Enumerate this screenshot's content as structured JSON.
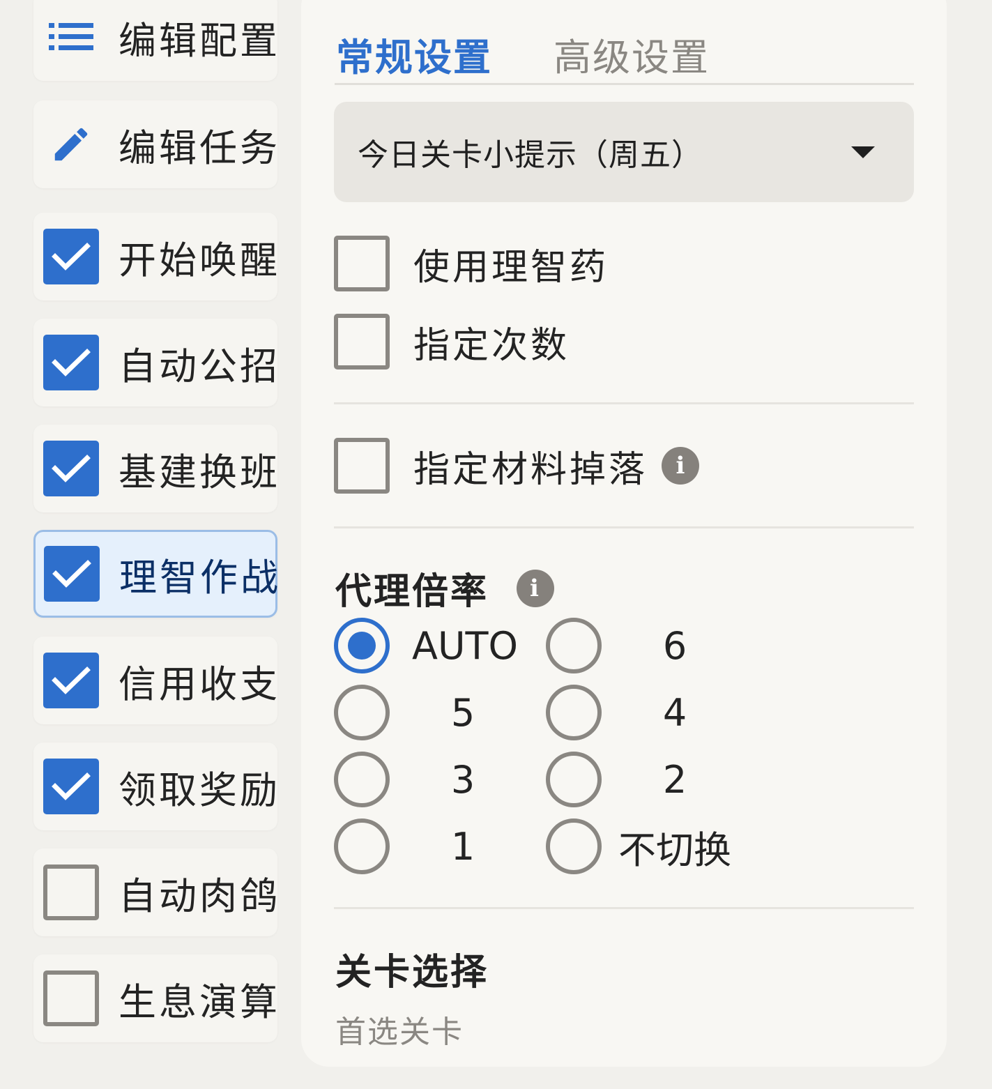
{
  "sidebar": {
    "items": [
      {
        "label": "编辑配置",
        "icon": "list-icon",
        "state": "icon"
      },
      {
        "label": "编辑任务",
        "icon": "pencil-icon",
        "state": "icon"
      },
      {
        "label": "开始唤醒",
        "state": "checked"
      },
      {
        "label": "自动公招",
        "state": "checked"
      },
      {
        "label": "基建换班",
        "state": "checked"
      },
      {
        "label": "理智作战",
        "state": "checked",
        "active": true
      },
      {
        "label": "信用收支",
        "state": "checked"
      },
      {
        "label": "领取奖励",
        "state": "checked"
      },
      {
        "label": "自动肉鸽",
        "state": "unchecked"
      },
      {
        "label": "生息演算",
        "state": "unchecked"
      }
    ]
  },
  "tabs": {
    "general": "常规设置",
    "advanced": "高级设置",
    "active": "general"
  },
  "stage_tip_dropdown": {
    "value": "今日关卡小提示（周五）"
  },
  "options": {
    "use_sanity_potion": {
      "label": "使用理智药",
      "checked": false
    },
    "specify_times": {
      "label": "指定次数",
      "checked": false
    },
    "specify_drops": {
      "label": "指定材料掉落",
      "checked": false
    }
  },
  "proxy_rate": {
    "title": "代理倍率",
    "selected": "AUTO",
    "options": [
      "AUTO",
      "6",
      "5",
      "4",
      "3",
      "2",
      "1",
      "不切换"
    ]
  },
  "stage_select": {
    "title": "关卡选择",
    "primary_label": "首选关卡"
  },
  "colors": {
    "accent": "#2e6fcc",
    "background": "#f1f0ec",
    "panel": "#f8f7f3",
    "muted": "#8a8782"
  }
}
